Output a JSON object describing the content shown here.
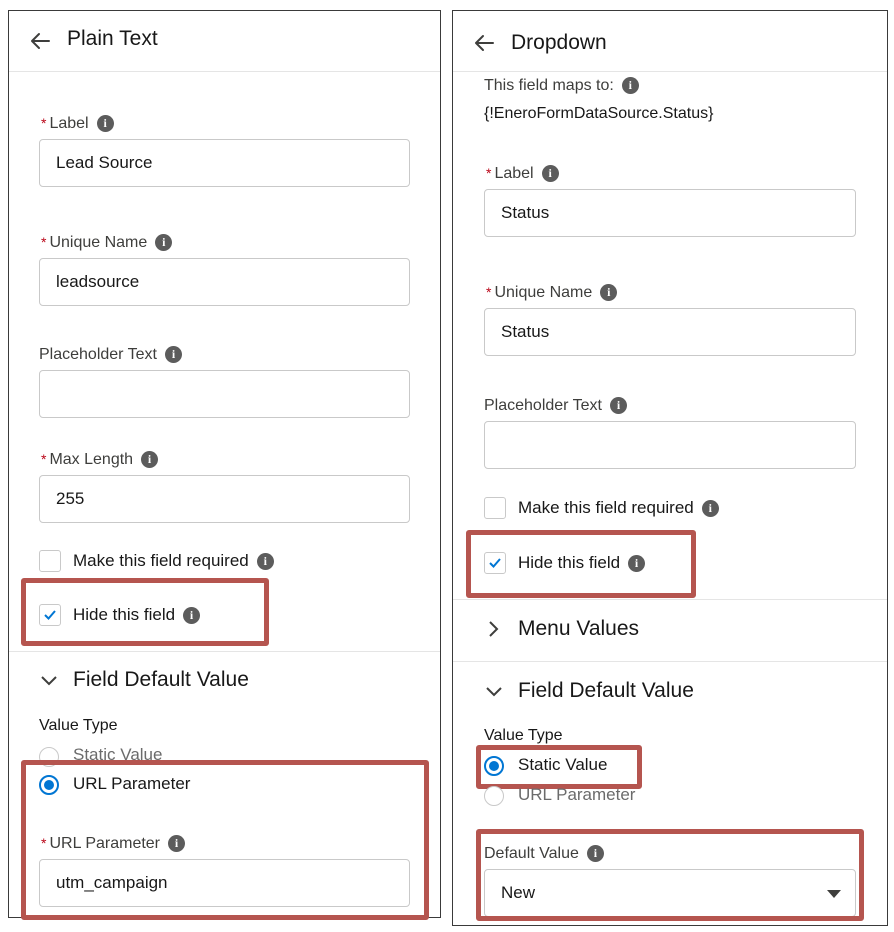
{
  "left": {
    "title": "Plain Text",
    "label": {
      "text": "Label",
      "value": "Lead Source"
    },
    "unique_name": {
      "text": "Unique Name",
      "value": "leadsource"
    },
    "placeholder": {
      "text": "Placeholder Text",
      "value": ""
    },
    "max_length": {
      "text": "Max Length",
      "value": "255"
    },
    "required_checkbox": {
      "text": "Make this field required",
      "checked": false
    },
    "hide_checkbox": {
      "text": "Hide this field",
      "checked": true
    },
    "default_section": "Field Default Value",
    "value_type_label": "Value Type",
    "radio_static": "Static Value",
    "radio_url": "URL Parameter",
    "url_param": {
      "text": "URL Parameter",
      "value": "utm_campaign"
    }
  },
  "right": {
    "title": "Dropdown",
    "maps_to_label": "This field maps to:",
    "maps_to_value": "{!EneroFormDataSource.Status}",
    "label": {
      "text": "Label",
      "value": "Status"
    },
    "unique_name": {
      "text": "Unique Name",
      "value": "Status"
    },
    "placeholder": {
      "text": "Placeholder Text",
      "value": ""
    },
    "required_checkbox": {
      "text": "Make this field required",
      "checked": false
    },
    "hide_checkbox": {
      "text": "Hide this field",
      "checked": true
    },
    "menu_values_section": "Menu Values",
    "default_section": "Field Default Value",
    "value_type_label": "Value Type",
    "radio_static": "Static Value",
    "radio_url": "URL Parameter",
    "default_value": {
      "text": "Default Value",
      "value": "New"
    }
  },
  "colors": {
    "accent": "#0176d3",
    "highlight": "#b5554f",
    "required": "#ba0517"
  },
  "icons": [
    "back-arrow-icon",
    "info-icon",
    "checkmark-icon",
    "chevron-down-icon",
    "chevron-right-icon",
    "select-caret-icon"
  ]
}
